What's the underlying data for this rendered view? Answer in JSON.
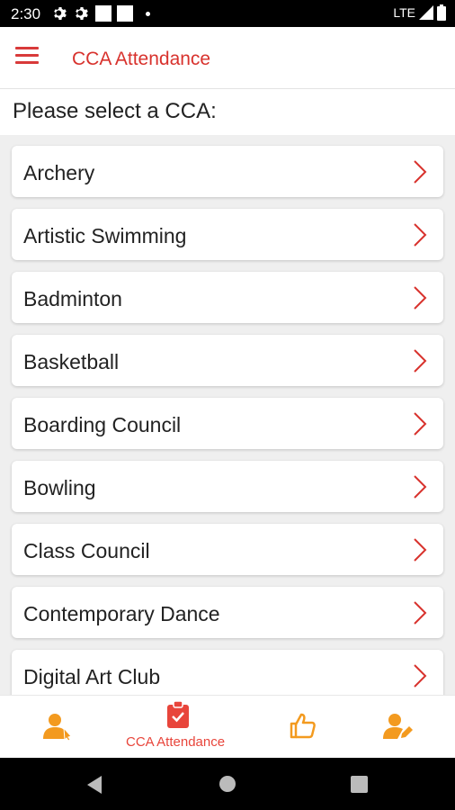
{
  "status_bar": {
    "time": "2:30",
    "network": "LTE"
  },
  "app_bar": {
    "title": "CCA Attendance",
    "menu_icon": "hamburger-menu-icon"
  },
  "prompt": "Please select a CCA:",
  "cca_list": [
    {
      "label": "Archery"
    },
    {
      "label": "Artistic Swimming"
    },
    {
      "label": "Badminton"
    },
    {
      "label": "Basketball"
    },
    {
      "label": "Boarding Council"
    },
    {
      "label": "Bowling"
    },
    {
      "label": "Class Council"
    },
    {
      "label": "Contemporary Dance"
    },
    {
      "label": "Digital Art Club"
    }
  ],
  "bottom_nav": {
    "items": [
      {
        "icon": "person-pointer-icon",
        "label": ""
      },
      {
        "icon": "clipboard-check-icon",
        "label": "CCA Attendance",
        "active": true
      },
      {
        "icon": "thumbs-up-icon",
        "label": ""
      },
      {
        "icon": "person-edit-icon",
        "label": ""
      }
    ]
  },
  "colors": {
    "accent": "#d8322d",
    "nav_icon": "#f39a1f",
    "list_background": "#efefef"
  }
}
